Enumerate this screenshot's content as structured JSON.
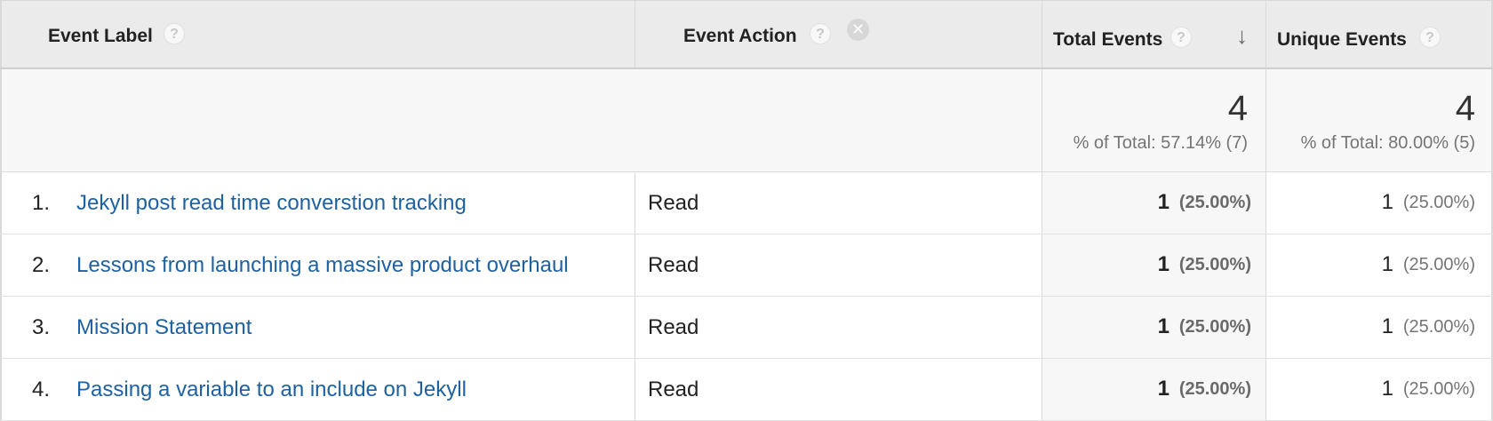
{
  "header": {
    "event_label": "Event Label",
    "event_action": "Event Action",
    "total_events": "Total Events",
    "unique_events": "Unique Events",
    "help_glyph": "?",
    "remove_glyph": "✕",
    "sort_glyph": "↓",
    "sort_direction": "descending",
    "sorted_column": "Total Events"
  },
  "summary": {
    "total_events_value": "4",
    "total_events_pct": "% of Total: 57.14% (7)",
    "unique_events_value": "4",
    "unique_events_pct": "% of Total: 80.00% (5)"
  },
  "rows": [
    {
      "index": "1.",
      "label": "Jekyll post read time converstion tracking",
      "action": "Read",
      "total": "1",
      "total_pct": "(25.00%)",
      "unique": "1",
      "unique_pct": "(25.00%)"
    },
    {
      "index": "2.",
      "label": "Lessons from launching a massive product overhaul",
      "action": "Read",
      "total": "1",
      "total_pct": "(25.00%)",
      "unique": "1",
      "unique_pct": "(25.00%)"
    },
    {
      "index": "3.",
      "label": "Mission Statement",
      "action": "Read",
      "total": "1",
      "total_pct": "(25.00%)",
      "unique": "1",
      "unique_pct": "(25.00%)"
    },
    {
      "index": "4.",
      "label": "Passing a variable to an include on Jekyll",
      "action": "Read",
      "total": "1",
      "total_pct": "(25.00%)",
      "unique": "1",
      "unique_pct": "(25.00%)"
    }
  ],
  "colors": {
    "link": "#1e61a3",
    "header_bg": "#ebebeb",
    "summary_bg": "#f7f7f7"
  }
}
